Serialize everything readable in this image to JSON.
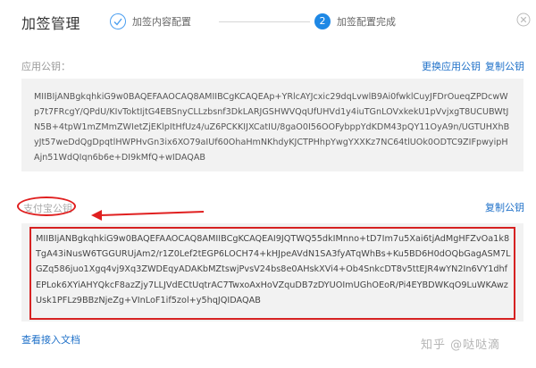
{
  "dialog": {
    "title": "加签管理",
    "close_icon": "close-icon"
  },
  "steps": [
    {
      "label": "加签内容配置",
      "status": "done",
      "icon": "check-icon"
    },
    {
      "number": "2",
      "label": "加签配置完成",
      "status": "active"
    }
  ],
  "app_key": {
    "label": "应用公钥：",
    "replace_link": "更换应用公钥",
    "copy_link": "复制公钥",
    "value": "MIIBIjANBgkqhkiG9w0BAQEFAAOCAQ8AMIIBCgKCAQEAp+YRlcAYJcxic29dqLvwlB9Ai0fwklCuyJFDrOueqZPDcwWp7t7FRcgY/QPdU/KIvToktIjtG4EBSnyCLLzbsnf3DkLARJGSHWVQqUfUHVd1y4iuTGnLOVxkekU1pVvjxgT8UCUBWtJN5B+4tpW1mZMmZWIetZjEKlpItHfUz4/uZ6PCKKIJXCatIU/8gaO0I56OOFybppYdKDM43pQY11OyA9n/UGTUHXhByJt57weDdQgDpqtlHWPHvGn3ix6XO79aIUf60OhaHmNKhdyKJCTPHhpYwgYXXKz7NC64tlUOk0ODTC9ZIFpwyipHAjn51WdQIqn6b6e+DI9kMfQ+wIDAQAB"
  },
  "alipay_key": {
    "label": "支付宝公钥",
    "copy_link": "复制公钥",
    "value": "MIIBIjANBgkqhkiG9w0BAQEFAAOCAQ8AMIIBCgKCAQEAI9JQTWQ55dkIMnno+tD7Im7u5Xai6tjAdMgHFZvOa1k8TgA43iNusW6TGGURUjAm2/r1Z0Lef2tEGP6LOCH74+kHJpeAVdN1SA3fyATqWhBs+Ku5BD6H0dOQbGagASM7LGZq586juo1Xgq4vj9Xq3ZWDEqyADAKbMZtswjPvsV24bs8e0AHskXVi4+Ob4SnkcDT8v5ttEJR4wYN2In6VY1dhfEPLok6XYiAHYQkcF8azZjy7LLJVdECtUqtrAC7TwxoAxHoVZquDB7zDYUOImUGhOEoR/Pi4EYBDWKqO9LuWKAwzUsk1PFLz9BBzNjeZg+VInLoF1if5zol+y5hqJQIDAQAB"
  },
  "footer": {
    "docs_link": "查看接入文档",
    "watermark": "知乎 @哒哒滴"
  },
  "colors": {
    "accent": "#1e88e5",
    "link": "#1e70c8",
    "annotation": "#e02020",
    "key_background": "#f2f2f2"
  }
}
